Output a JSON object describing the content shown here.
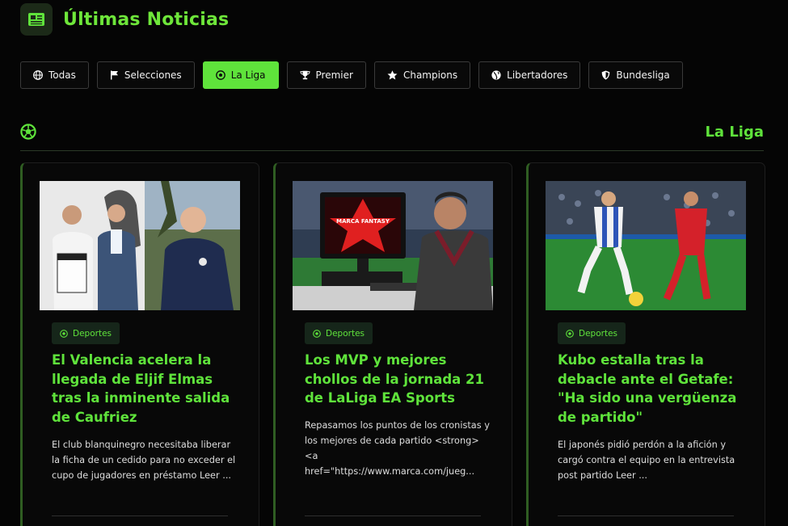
{
  "header": {
    "title": "Últimas Noticias",
    "icon": "newspaper-icon"
  },
  "filters": [
    {
      "label": "Todas",
      "icon": "globe-icon",
      "active": false
    },
    {
      "label": "Selecciones",
      "icon": "flag-icon",
      "active": false
    },
    {
      "label": "La Liga",
      "icon": "soccer-ball-icon",
      "active": true
    },
    {
      "label": "Premier",
      "icon": "trophy-icon",
      "active": false
    },
    {
      "label": "Champions",
      "icon": "star-icon",
      "active": false
    },
    {
      "label": "Libertadores",
      "icon": "globe-americas-icon",
      "active": false
    },
    {
      "label": "Bundesliga",
      "icon": "shield-icon",
      "active": false
    }
  ],
  "section": {
    "title": "La Liga",
    "icon": "soccer-ball-icon"
  },
  "cards": [
    {
      "badge": "Deportes",
      "title": "El Valencia acelera la llegada de Eljif Elmas tras la inminente salida de Caufriez",
      "excerpt": "El club blanquinegro necesitaba liberar la ficha de un cedido para no exceder el cupo de jugadores en préstamo  Leer ...",
      "image": "valencia-signing-photo"
    },
    {
      "badge": "Deportes",
      "title": "Los MVP y mejores chollos de la jornada 21 de LaLiga EA Sports",
      "excerpt": "Repasamos los puntos de los cronistas y los mejores de cada partido <strong><a href=\"https://www.marca.com/jueg...",
      "image": "marca-fantasy-photo",
      "image_text": "MARCA FANTASY"
    },
    {
      "badge": "Deportes",
      "title": "Kubo estalla tras la debacle ante el Getafe: \"Ha sido una vergüenza de partido\"",
      "excerpt": "El japonés pidió perdón a la afición y cargó contra el equipo en la entrevista post partido  Leer ...",
      "image": "kubo-match-photo"
    }
  ],
  "colors": {
    "accent": "#5fe33b",
    "background": "#050505"
  }
}
